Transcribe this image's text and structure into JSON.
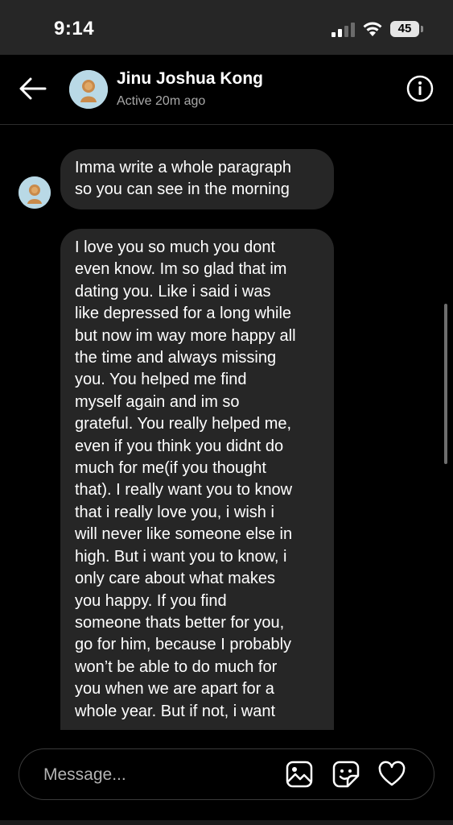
{
  "status_bar": {
    "time": "9:14",
    "battery": "45",
    "icons": [
      "cellular-signal-icon",
      "wifi-icon",
      "battery-icon"
    ]
  },
  "header": {
    "back_icon": "arrow-left-icon",
    "contact_name": "Jinu Joshua Kong",
    "active_status": "Active 20m ago",
    "info_icon": "info-icon"
  },
  "messages": [
    {
      "sender": "contact",
      "text": "Imma write a whole paragraph\nso you can see in the morning"
    },
    {
      "sender": "contact",
      "text": "I love you so much you dont\neven know. Im so glad that im\ndating you. Like i said i was\nlike depressed for a long while\nbut now im way more happy all\nthe time and always missing\nyou. You helped me find\nmyself again and im so\ngrateful. You really helped me,\neven if you think you didnt do\nmuch for me(if you thought\nthat). I really want you to know\nthat i really love you, i wish i\nwill never like someone else in\nhigh. But i want you to know, i\nonly care about what makes\nyou happy. If you find\nsomeone thats better for you,\ngo for him, because I probably\nwon’t be able to do much for\nyou when we are apart for a\nwhole year. But if not, i want"
    }
  ],
  "composer": {
    "placeholder": "Message...",
    "icons": [
      "image-icon",
      "sticker-icon",
      "heart-icon"
    ]
  },
  "colors": {
    "background": "#000000",
    "status_bar": "#262626",
    "bubble": "#262626",
    "secondary_text": "#a8a8a8",
    "avatar_bg": "#b9d9e6"
  }
}
